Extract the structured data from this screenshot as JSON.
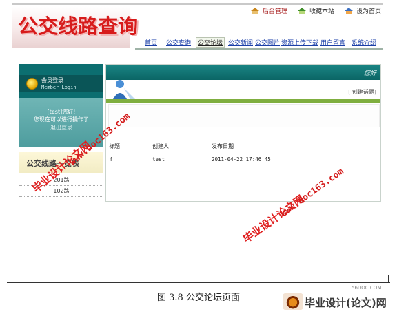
{
  "header": {
    "logo_text": "公交线路查询",
    "top_links": [
      {
        "label": "后台管理",
        "icon": "admin-house-icon"
      },
      {
        "label": "收藏本站",
        "icon": "bookmark-house-icon"
      },
      {
        "label": "设为首页",
        "icon": "homepage-icon"
      }
    ],
    "nav": [
      {
        "label": "首页"
      },
      {
        "label": "公交查询"
      },
      {
        "label": "公交论坛",
        "active": true
      },
      {
        "label": "公交新闻"
      },
      {
        "label": "公交图片"
      },
      {
        "label": "资源上传下载"
      },
      {
        "label": "用户留言"
      },
      {
        "label": "系统介绍"
      }
    ]
  },
  "sidebar": {
    "login_title": "会员登录",
    "login_subtitle": "Member Login",
    "greeting_line1": "[test]您好!",
    "greeting_line2": "您现在可以进行操作了",
    "greeting_line3": "退出登录",
    "routes_title": "公交线路一览表",
    "routes": [
      {
        "label": "201路"
      },
      {
        "label": "102路"
      }
    ]
  },
  "forum": {
    "header_greeting": "您好",
    "create_topic_label": "[ 创建话题]",
    "columns": [
      "标题",
      "创建人",
      "发布日期"
    ],
    "rows": [
      {
        "title": "f",
        "creator": "test",
        "date": "2011-04-22 17:46:45"
      }
    ]
  },
  "caption": "图 3.8 公交论坛页面",
  "watermarks": {
    "text_cn": "毕业设计论文网",
    "text_url": "www.doc163.com"
  },
  "corner_logo": {
    "text": "毕业设计(论文)网",
    "small": "56DOC.COM"
  },
  "colors": {
    "brand_red": "#d71b1b",
    "teal": "#0c6e70",
    "green_bar": "#7fae3f",
    "nav_blue": "#1b3fa8"
  }
}
